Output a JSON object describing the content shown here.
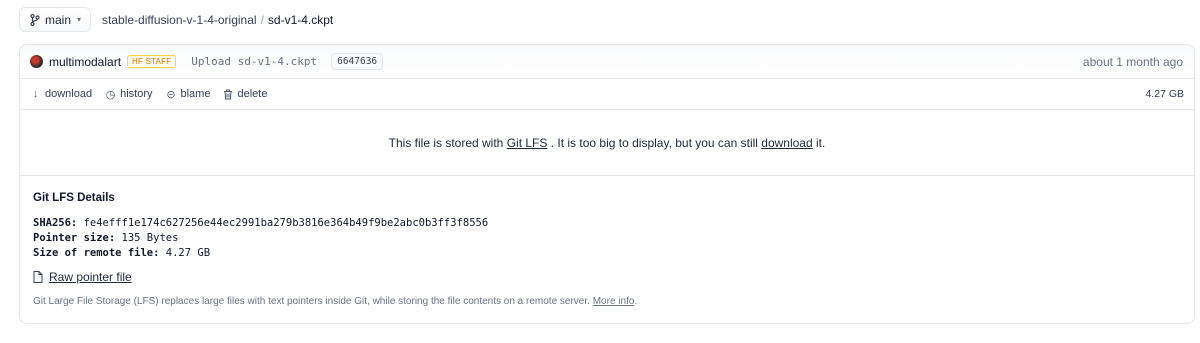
{
  "branch": {
    "label": "main",
    "icon": "git-branch-icon"
  },
  "breadcrumb": {
    "repo": "stable-diffusion-v-1-4-original",
    "separator": "/",
    "file": "sd-v1-4.ckpt"
  },
  "commit": {
    "author": "multimodalart",
    "badge": "HF STAFF",
    "message": "Upload sd-v1-4.ckpt",
    "hash": "6647636",
    "time": "about 1 month ago"
  },
  "actions": [
    {
      "label": "download",
      "icon": "download-arrow-icon"
    },
    {
      "label": "history",
      "icon": "clock-icon"
    },
    {
      "label": "blame",
      "icon": "blame-icon"
    },
    {
      "label": "delete",
      "icon": "trash-icon"
    }
  ],
  "file_size": "4.27 GB",
  "lfs_message": {
    "prefix": "This file is stored with ",
    "lfs_link": "Git LFS",
    "middle": " . It is too big to display, but you can still ",
    "download_link": "download",
    "suffix": " it."
  },
  "lfs_details": {
    "title": "Git LFS Details",
    "sha_label": "SHA256:",
    "sha_value": "fe4efff1e174c627256e44ec2991ba279b3816e364b49f9be2abc0b3ff3f8556",
    "pointer_label": "Pointer size:",
    "pointer_value": "135 Bytes",
    "remote_label": "Size of remote file:",
    "remote_value": "4.27 GB",
    "raw_link": "Raw pointer file",
    "footnote": "Git Large File Storage (LFS) replaces large files with text pointers inside Git, while storing the file contents on a remote server.",
    "more_info": "More info"
  }
}
